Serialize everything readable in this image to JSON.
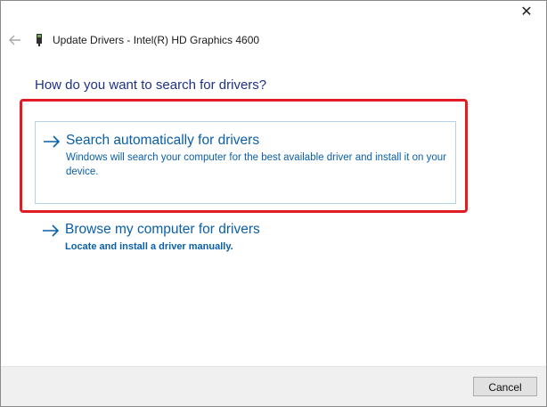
{
  "window": {
    "title": "Update Drivers - Intel(R) HD Graphics 4600",
    "close_glyph": "✕"
  },
  "heading": "How do you want to search for drivers?",
  "options": [
    {
      "title": "Search automatically for drivers",
      "description": "Windows will search your computer for the best available driver and install it on your device.",
      "icon": "arrow-right-icon"
    },
    {
      "title": "Browse my computer for drivers",
      "description": "Locate and install a driver manually.",
      "icon": "arrow-right-icon"
    }
  ],
  "footer": {
    "cancel_label": "Cancel"
  },
  "colors": {
    "link_blue": "#0a5fa8",
    "heading_blue": "#1e3287",
    "highlight_red": "#e21c25",
    "option_border": "#b5d2e7"
  },
  "icons": {
    "back": "back-arrow-icon",
    "device": "display-adapter-icon",
    "close": "close-icon"
  }
}
